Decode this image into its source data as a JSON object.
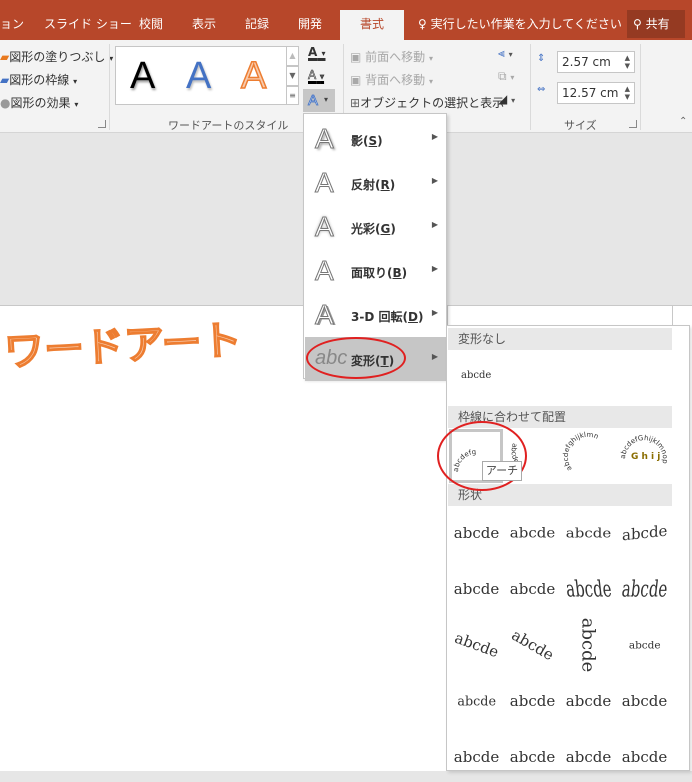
{
  "tabs": [
    {
      "label": "ョン"
    },
    {
      "label": "スライド ショー"
    },
    {
      "label": "校閲"
    },
    {
      "label": "表示"
    },
    {
      "label": "記録"
    },
    {
      "label": "開発"
    },
    {
      "label": "書式",
      "active": true
    }
  ],
  "tell_me": "実行したい作業を入力してください",
  "share": "共有",
  "ribbon": {
    "shape_styles": {
      "fill": "図形の塗りつぶし",
      "outline": "図形の枠線",
      "effects": "図形の効果"
    },
    "wordart_styles": {
      "label": "ワードアートのスタイル",
      "gallery": [
        "A",
        "A",
        "A"
      ],
      "text_fill": "A",
      "text_outline": "A",
      "text_effects": "A"
    },
    "arrange": {
      "bring_forward": "前面へ移動",
      "send_backward": "背面へ移動",
      "selection_pane": "オブジェクトの選択と表示"
    },
    "size": {
      "label": "サイズ",
      "height": "2.57 cm",
      "width": "12.57 cm"
    }
  },
  "slide": {
    "wordart_text": "ワードアート"
  },
  "effects_menu": [
    {
      "label": "影",
      "key": "S",
      "icon": "shadow-icon"
    },
    {
      "label": "反射",
      "key": "R",
      "icon": "reflection-icon"
    },
    {
      "label": "光彩",
      "key": "G",
      "icon": "glow-icon"
    },
    {
      "label": "面取り",
      "key": "B",
      "icon": "bevel-icon"
    },
    {
      "label": "3-D 回転",
      "key": "D",
      "icon": "3d-rotation-icon"
    },
    {
      "label": "変形",
      "key": "T",
      "icon": "transform-icon",
      "selected": true
    }
  ],
  "transform_submenu": {
    "no_transform": {
      "header": "変形なし",
      "sample": "abcde"
    },
    "follow_path": {
      "header": "枠線に合わせて配置",
      "items": [
        "abcdefg",
        "abcdefg",
        "abcdefghijklmn",
        "abcdefGhijklmnop"
      ],
      "tooltip": "アーチ"
    },
    "warp": {
      "header": "形状",
      "sample": "abcde",
      "rows": 5,
      "cols": 4
    }
  },
  "colors": {
    "accent": "#b7472a",
    "orange": "#ed7d31",
    "blue": "#4472c4",
    "highlight_circle": "#e02020"
  }
}
